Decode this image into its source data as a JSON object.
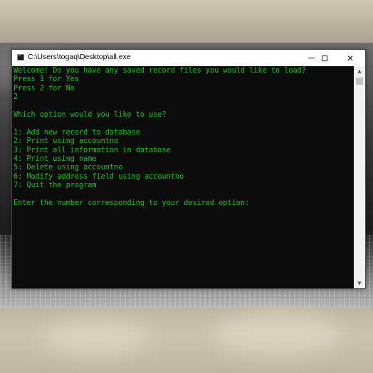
{
  "window": {
    "title": "C:\\Users\\togaq\\Desktop\\all.exe",
    "minimize_icon": "minimize-icon",
    "maximize_icon": "maximize-icon",
    "close_icon": "close-icon"
  },
  "console": {
    "text_color": "#16c60c",
    "background": "#0c0c0c",
    "lines": [
      "Welcome! Do you have any saved record files you would like to load?",
      "Press 1 for Yes",
      "Press 2 for No",
      "2",
      "",
      "Which option would you like to use?",
      "",
      "1: Add new record to database",
      "2: Print using accountno",
      "3: Print all information in database",
      "4: Print using name",
      "5: Delete using accountno",
      "6: Modify address field using accountno",
      "7: Quit the program",
      "",
      "Enter the number corresponding to your desired option:"
    ]
  },
  "scrollbar": {
    "up_icon": "scroll-up-arrow-icon",
    "down_icon": "scroll-down-arrow-icon",
    "position": 0
  }
}
